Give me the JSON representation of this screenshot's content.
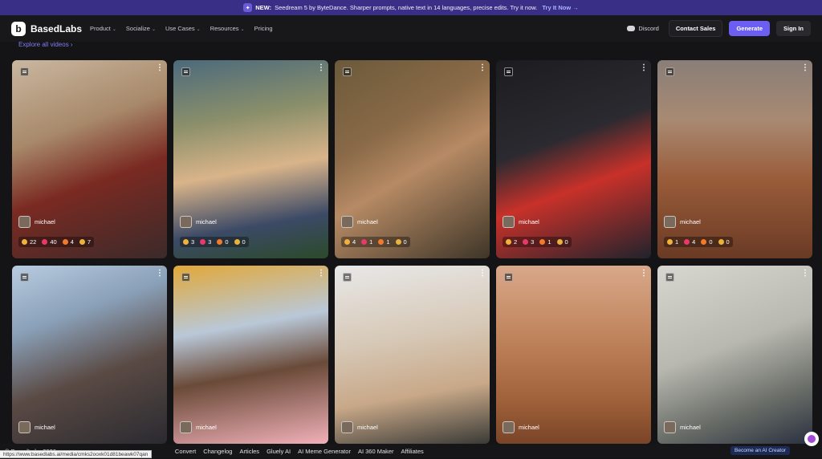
{
  "banner": {
    "new_label": "NEW:",
    "text": "Seedream 5 by ByteDance. Sharper prompts, native text in 14 languages, precise edits. Try it now.",
    "link": "Try It Now →"
  },
  "nav": {
    "brand": "BasedLabs",
    "menu": [
      {
        "label": "Product",
        "has_chevron": true
      },
      {
        "label": "Socialize",
        "has_chevron": true
      },
      {
        "label": "Use Cases",
        "has_chevron": true
      },
      {
        "label": "Resources",
        "has_chevron": true
      },
      {
        "label": "Pricing",
        "has_chevron": false
      }
    ],
    "discord": "Discord",
    "contact": "Contact Sales",
    "generate": "Generate",
    "signin": "Sign In"
  },
  "explore_link": "Explore all videos ›",
  "cards": [
    {
      "user": "michael",
      "reactions": [
        "22",
        "40",
        "4",
        "7"
      ],
      "bg": "linear-gradient(160deg,#c9b7a0 0%,#a8896a 35%,#7a2a22 60%,#3b2a2a 100%)"
    },
    {
      "user": "michael",
      "reactions": [
        "3",
        "3",
        "0",
        "0"
      ],
      "bg": "linear-gradient(170deg,#4c6a7c 0%,#8a8f6a 30%,#d9b48a 55%,#3c4a66 80%,#2b4a2a 100%)"
    },
    {
      "user": "michael",
      "reactions": [
        "4",
        "1",
        "1",
        "0"
      ],
      "bg": "linear-gradient(150deg,#6b5a3a 0%,#8a6a48 35%,#b68a64 55%,#3e3528 100%)"
    },
    {
      "user": "michael",
      "reactions": [
        "2",
        "3",
        "1",
        "0"
      ],
      "bg": "linear-gradient(160deg,#1c1c20 0%,#2a2a30 40%,#c8312a 62%,#20232c 100%)"
    },
    {
      "user": "michael",
      "reactions": [
        "1",
        "4",
        "0",
        "0"
      ],
      "bg": "linear-gradient(180deg,#8a7e78 0%,#a88a72 30%,#9a5c3a 60%,#6a3a24 100%)"
    },
    {
      "user": "michael",
      "reactions": [],
      "bg": "linear-gradient(160deg,#b8cbe0 0%,#8aa0b8 30%,#5a4a44 60%,#2a2a30 100%)"
    },
    {
      "user": "michael",
      "reactions": [],
      "bg": "linear-gradient(170deg,#e2a838 0%,#b9c8d8 35%,#6a4a38 60%,#f0b0b8 100%)"
    },
    {
      "user": "michael",
      "reactions": [],
      "bg": "linear-gradient(170deg,#e8e8e8 0%,#d7c9b8 40%,#c8a888 70%,#3a3a36 100%)"
    },
    {
      "user": "michael",
      "reactions": [],
      "bg": "linear-gradient(180deg,#d8a88a 0%,#c0845c 40%,#a0623a 75%,#7a4428 100%)"
    },
    {
      "user": "michael",
      "reactions": [],
      "bg": "linear-gradient(160deg,#d8d6d0 0%,#b8b8b0 45%,#6a6e68 75%,#2a3040 100%)"
    }
  ],
  "reaction_colors": [
    "#f0b23a",
    "#e83a6a",
    "#f27a2a",
    "#e9b23a"
  ],
  "footer": {
    "links": [
      "© BasedLabs 2026",
      "Convert",
      "Changelog",
      "Articles",
      "Gluely AI",
      "AI Meme Generator",
      "AI 360 Maker",
      "Affiliates"
    ],
    "url": "https://www.basedlabs.ai/media/cmks2ooxk01d81beawk07qan",
    "creator_button": "Become an AI Creator"
  }
}
